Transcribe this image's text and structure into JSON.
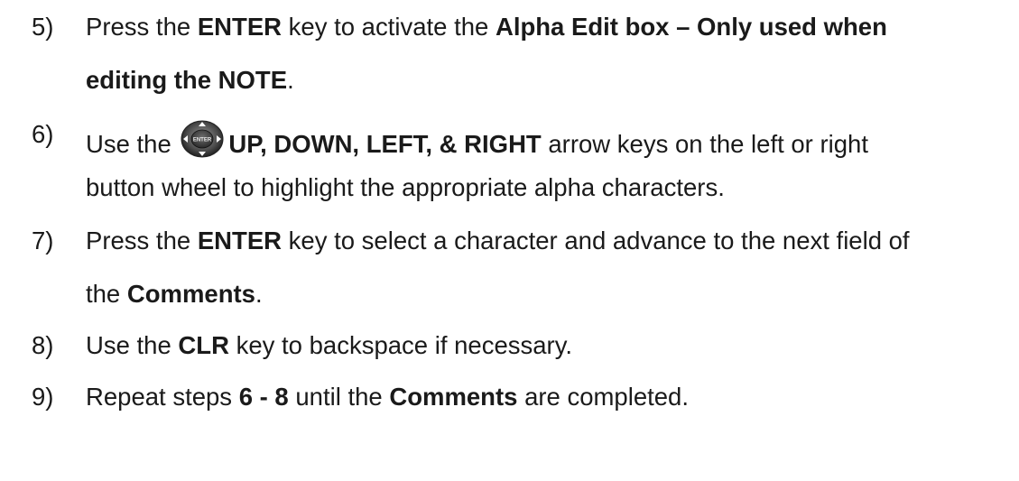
{
  "steps": [
    {
      "number": "5)",
      "lines": [
        [
          "Press the ",
          {
            "b": "ENTER"
          },
          " key to activate the ",
          {
            "b": "Alpha Edit box – Only used when"
          }
        ],
        [
          {
            "b": "editing the NOTE"
          },
          "."
        ]
      ]
    },
    {
      "number": "6)",
      "lines": [
        [
          "Use the ",
          {
            "icon": "nav-pad-icon"
          },
          {
            "b": "UP, DOWN, LEFT, & RIGHT"
          },
          " arrow keys on the left or right"
        ],
        [
          "button wheel to highlight the appropriate alpha characters."
        ]
      ]
    },
    {
      "number": "7)",
      "lines": [
        [
          "Press the ",
          {
            "b": "ENTER"
          },
          " key to select a character and advance to the next field of"
        ],
        [
          "the ",
          {
            "b": "Comments"
          },
          "."
        ]
      ]
    },
    {
      "number": "8)",
      "lines": [
        [
          "Use the ",
          {
            "b": "CLR"
          },
          " key to backspace if necessary."
        ]
      ]
    },
    {
      "number": "9)",
      "lines": [
        [
          "Repeat steps ",
          {
            "b": "6 - 8"
          },
          " until the ",
          {
            "b": "Comments"
          },
          " are completed."
        ]
      ]
    }
  ],
  "icon": {
    "name": "nav-pad-icon",
    "center_label": "ENTER"
  }
}
